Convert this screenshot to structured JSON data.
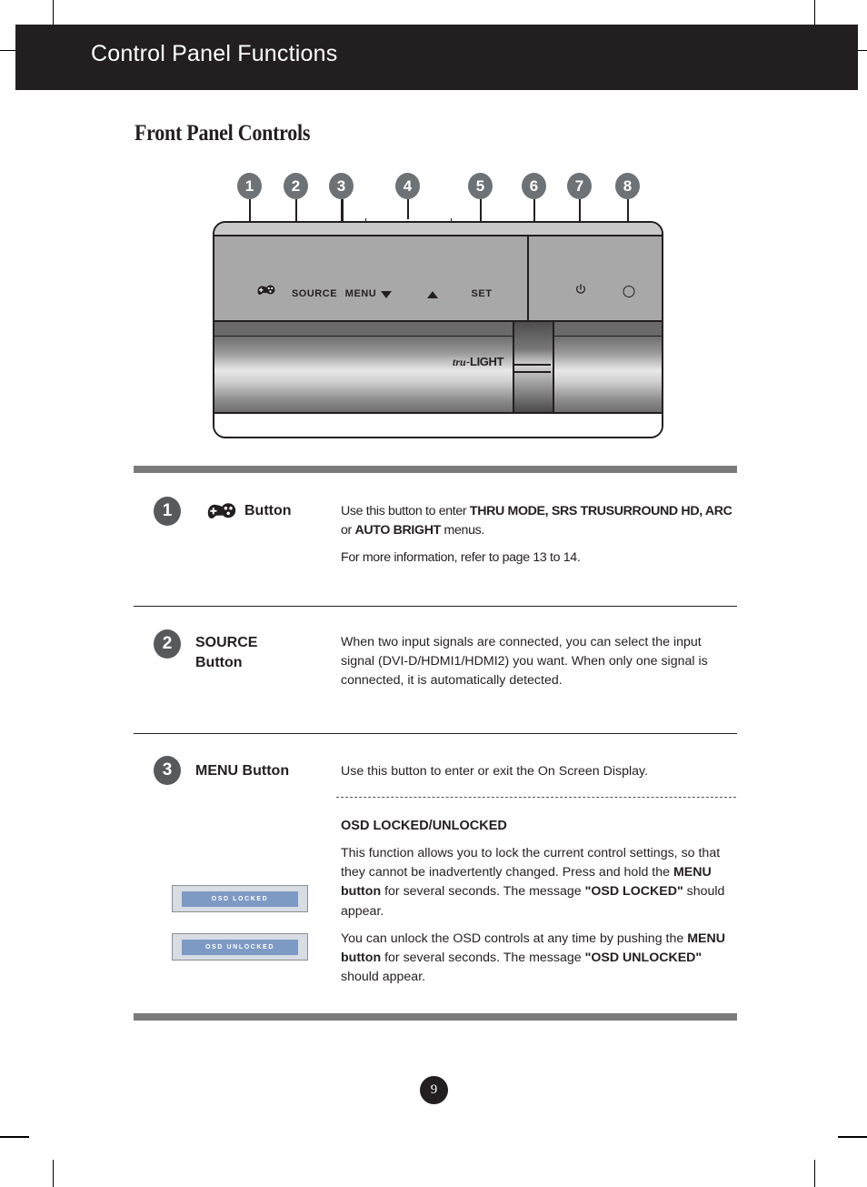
{
  "header": {
    "title": "Control Panel Functions"
  },
  "section": {
    "heading": "Front Panel Controls"
  },
  "diagram": {
    "callouts": [
      "1",
      "2",
      "3",
      "4",
      "5",
      "6",
      "7",
      "8"
    ],
    "panel_labels": {
      "gamepad": "gamepad-icon",
      "source": "SOURCE",
      "menu": "MENU",
      "down": "▼",
      "up": "▲",
      "set": "SET",
      "power": "power-icon",
      "led": "led-indicator"
    },
    "brand_logo": {
      "script": "tru",
      "dash": "-",
      "word": "LIGHT"
    }
  },
  "rows": [
    {
      "number": "1",
      "icon": "gamepad-icon",
      "label": "Button",
      "body_html": "<p>Use this button to enter <b>THRU MODE, SRS TRUSURROUND HD, ARC</b> or <b>AUTO BRIGHT</b> menus.</p><p>For more information, refer to page 13 to 14.</p>"
    },
    {
      "number": "2",
      "label": "SOURCE\nButton",
      "body_html": "<p>When two input signals are connected, you can select the input signal (DVI-D/HDMI1/HDMI2) you want. When only one signal is connected, it is automatically detected.</p>"
    },
    {
      "number": "3",
      "label": "MENU Button",
      "body_html": "<p>Use this button to enter or exit the On Screen Display.</p>"
    }
  ],
  "osd": {
    "sub_heading": "OSD LOCKED/UNLOCKED",
    "paragraph_1_html": "This function allows you to lock the current control settings, so that they cannot be inadvertently changed. Press and hold the <b>MENU button</b> for several seconds. The message <b>\"OSD LOCKED\"</b> should appear.",
    "paragraph_2_html": "You can unlock the OSD controls at any time by pushing the <b>MENU button</b> for several seconds. The message <b>\"OSD UNLOCKED\"</b> should appear.",
    "badge_locked": "OSD LOCKED",
    "badge_unlocked": "OSD UNLOCKED"
  },
  "footer": {
    "page_number": "9"
  },
  "colors": {
    "header_bg": "#231f20",
    "rule_gray": "#7b7b7b",
    "badge_gray": "#58595b",
    "callout_gray": "#6d7276",
    "osd_blue": "#7d9ac4",
    "osd_box_bg": "#d8dce3"
  }
}
